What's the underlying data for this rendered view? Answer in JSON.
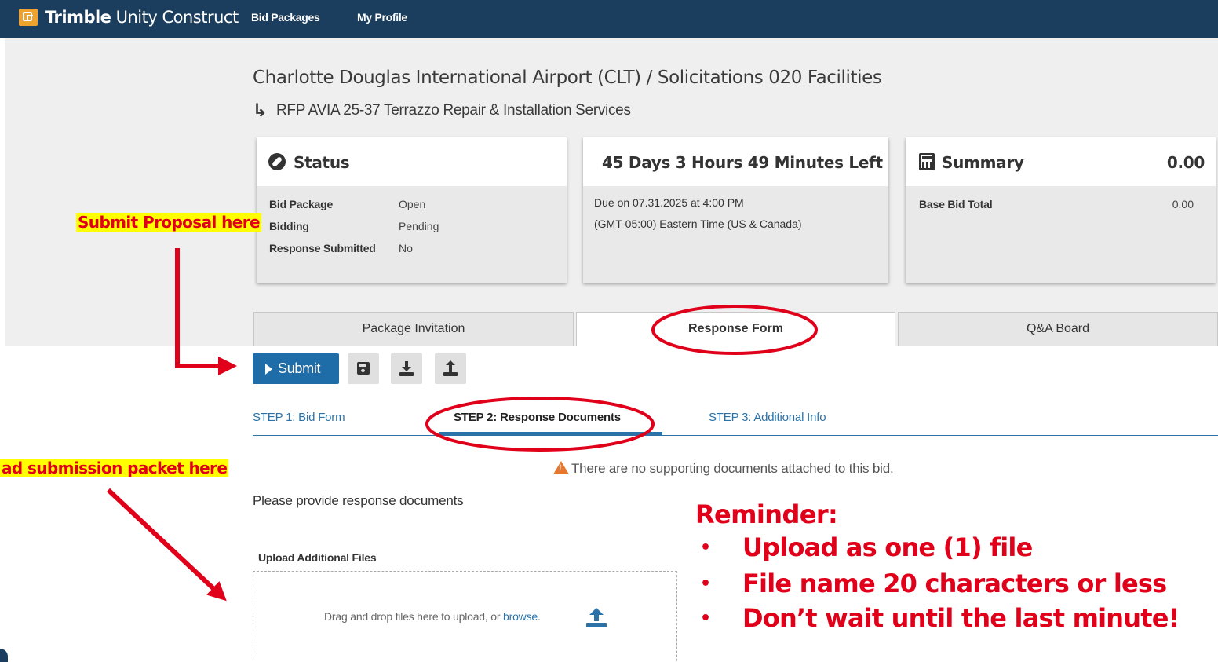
{
  "header": {
    "brand_bold": "Trimble",
    "brand_rest": " Unity Construct",
    "nav": [
      "Bid Packages",
      "My Profile"
    ]
  },
  "page": {
    "title": "Charlotte Douglas International Airport (CLT) / Solicitations 020 Facilities",
    "subtitle": "RFP AVIA 25-37 Terrazzo Repair & Installation Services"
  },
  "status_card": {
    "title": "Status",
    "rows": [
      {
        "label": "Bid Package",
        "value": "Open"
      },
      {
        "label": "Bidding",
        "value": "Pending"
      },
      {
        "label": "Response Submitted",
        "value": "No"
      }
    ]
  },
  "time_card": {
    "title": "45 Days 3 Hours 49 Minutes Left",
    "due": "Due on 07.31.2025 at 4:00 PM",
    "timezone": "(GMT-05:00) Eastern Time (US & Canada)"
  },
  "summary_card": {
    "title": "Summary",
    "total": "0.00",
    "row_label": "Base Bid Total",
    "row_value": "0.00"
  },
  "tabs": [
    {
      "label": "Package Invitation",
      "active": false
    },
    {
      "label": "Response Form",
      "active": true
    },
    {
      "label": "Q&A Board",
      "active": false
    }
  ],
  "toolbar": {
    "submit_label": "Submit"
  },
  "steps": [
    {
      "label": "STEP 1: Bid Form",
      "active": false
    },
    {
      "label": "STEP 2: Response Documents",
      "active": true
    },
    {
      "label": "STEP 3: Additional Info",
      "active": false
    }
  ],
  "documents": {
    "warning": "There are no supporting documents attached to this bid.",
    "prompt": "Please provide response documents",
    "upload_label": "Upload Additional Files",
    "drop_text": "Drag and drop files here to upload, or ",
    "browse_link": "browse."
  },
  "annotations": {
    "submit_note": "Submit Proposal here",
    "upload_note": "ad submission packet here",
    "reminder_title": "Reminder:",
    "reminder_bullet": "•",
    "reminder_items": [
      "Upload as one (1) file",
      "File name 20 characters or less",
      "Don’t wait until the last minute!"
    ]
  },
  "colors": {
    "navbar": "#1b3e5e",
    "logo": "#f0a22e",
    "primary_button": "#1f6da8",
    "link": "#2a72a8",
    "annotation_red": "#e0001a",
    "highlight_yellow": "#ffff00",
    "warning_orange": "#e8772e"
  },
  "icons": [
    "compass-icon",
    "calculator-icon",
    "play-icon",
    "save-icon",
    "download-icon",
    "upload-icon",
    "warning-icon",
    "upload-cloud-icon"
  ]
}
